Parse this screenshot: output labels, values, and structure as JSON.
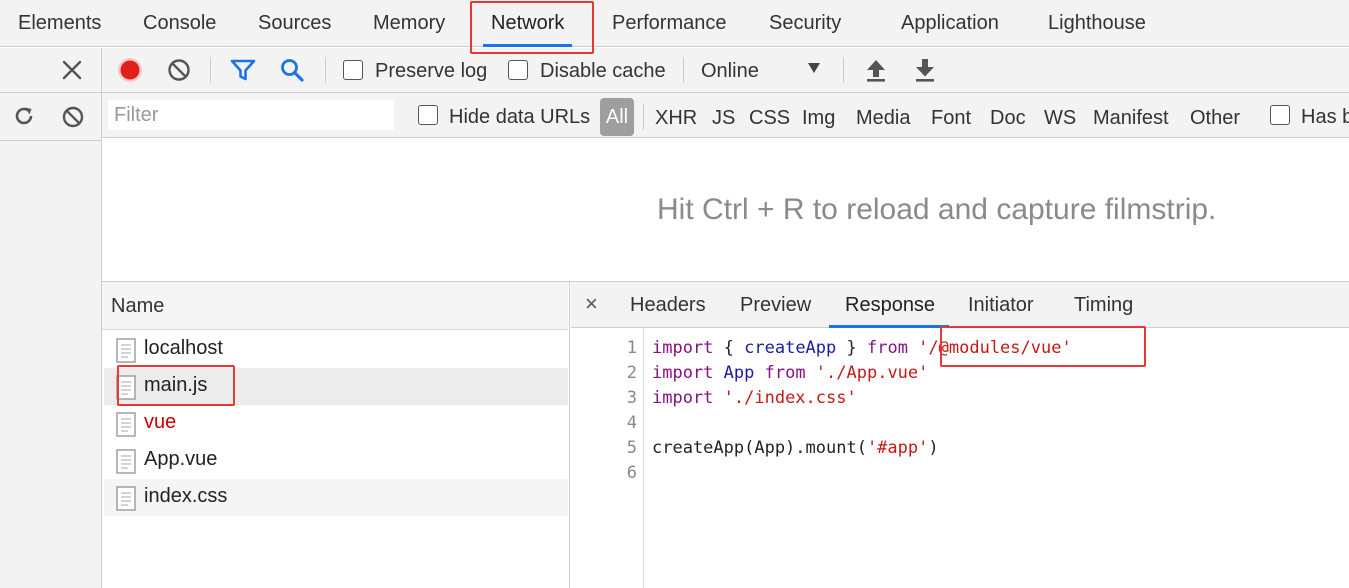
{
  "tabs": [
    {
      "label": "Elements"
    },
    {
      "label": "Console"
    },
    {
      "label": "Sources"
    },
    {
      "label": "Memory"
    },
    {
      "label": "Network"
    },
    {
      "label": "Performance"
    },
    {
      "label": "Security"
    },
    {
      "label": "Application"
    },
    {
      "label": "Lighthouse"
    }
  ],
  "active_tab": "Network",
  "toolbar": {
    "preserve_log": "Preserve log",
    "disable_cache": "Disable cache",
    "throttle": "Online"
  },
  "filterbar": {
    "filter_placeholder": "Filter",
    "hide_data_urls": "Hide data URLs",
    "all": "All",
    "types": [
      "XHR",
      "JS",
      "CSS",
      "Img",
      "Media",
      "Font",
      "Doc",
      "WS",
      "Manifest",
      "Other"
    ],
    "has_blocked": "Has b"
  },
  "filmstrip": {
    "message": "Hit Ctrl + R to reload and capture filmstrip."
  },
  "request_list": {
    "header": "Name",
    "rows": [
      {
        "name": "localhost",
        "error": false
      },
      {
        "name": "main.js",
        "error": false
      },
      {
        "name": "vue",
        "error": true
      },
      {
        "name": "App.vue",
        "error": false
      },
      {
        "name": "index.css",
        "error": false
      }
    ]
  },
  "detail": {
    "close": "×",
    "tabs": [
      "Headers",
      "Preview",
      "Response",
      "Initiator",
      "Timing"
    ],
    "active_tab": "Response",
    "lines": [
      "1",
      "2",
      "3",
      "4",
      "5",
      "6"
    ],
    "code": {
      "l1_kw1": "import",
      "l1_p1": " { ",
      "l1_id": "createApp",
      "l1_p2": " } ",
      "l1_kw2": "from",
      "l1_str": " '/@modules/vue'",
      "l2_kw1": "import",
      "l2_id": " App ",
      "l2_kw2": "from",
      "l2_str": " './App.vue'",
      "l3_kw1": "import",
      "l3_str": " './index.css'",
      "l5_p1": "createApp(App).mount(",
      "l5_str": "'#app'",
      "l5_p2": ")"
    }
  },
  "colors": {
    "accent": "#1a73e8",
    "record": "#e0201a",
    "error_text": "#c80000",
    "annotation": "#e53935"
  }
}
